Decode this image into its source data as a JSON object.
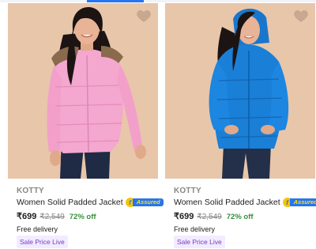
{
  "colors": {
    "image_background": "#e8c6aa",
    "discount_green": "#388e3c",
    "assured_blue": "#2874f0",
    "assured_yellow": "#ffe500",
    "sale_badge_bg": "#f3ebff",
    "sale_badge_text": "#6f3ec1"
  },
  "products": [
    {
      "brand": "KOTTY",
      "title": "Women Solid Padded Jacket",
      "assured_label": "Assured",
      "assured_icon_letter": "f",
      "price": "₹699",
      "mrp": "₹2,549",
      "discount": "72% off",
      "delivery": "Free delivery",
      "badge": "Sale Price Live",
      "jacket_color": "#f4a7cf",
      "wishlist_icon": "heart-icon"
    },
    {
      "brand": "KOTTY",
      "title": "Women Solid Padded Jacket",
      "assured_label": "Assured",
      "assured_icon_letter": "f",
      "price": "₹699",
      "mrp": "₹2,549",
      "discount": "72% off",
      "delivery": "Free delivery",
      "badge": "Sale Price Live",
      "jacket_color": "#1a7fd6",
      "wishlist_icon": "heart-icon"
    }
  ]
}
